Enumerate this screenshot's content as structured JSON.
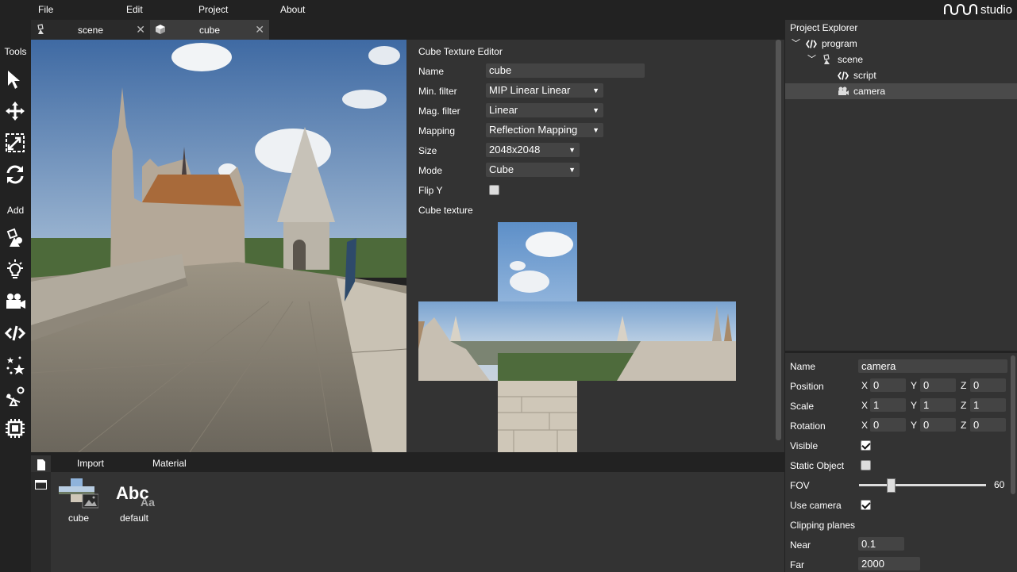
{
  "menu": {
    "file": "File",
    "edit": "Edit",
    "project": "Project",
    "about": "About"
  },
  "logo": {
    "text": "studio"
  },
  "tabs": [
    {
      "label": "scene",
      "icon": "scene-icon",
      "active": false
    },
    {
      "label": "cube",
      "icon": "cube-icon",
      "active": true
    }
  ],
  "tools": {
    "tools_heading": "Tools",
    "add_heading": "Add"
  },
  "editor": {
    "title": "Cube Texture Editor",
    "name_label": "Name",
    "name_value": "cube",
    "min_filter_label": "Min. filter",
    "min_filter_value": "MIP Linear Linear",
    "mag_filter_label": "Mag. filter",
    "mag_filter_value": "Linear",
    "mapping_label": "Mapping",
    "mapping_value": "Reflection Mapping",
    "size_label": "Size",
    "size_value": "2048x2048",
    "mode_label": "Mode",
    "mode_value": "Cube",
    "flipy_label": "Flip Y",
    "flipy_checked": false,
    "cube_texture_label": "Cube texture"
  },
  "assets": {
    "tabs": [
      "Import",
      "Material"
    ],
    "items": [
      {
        "label": "cube"
      },
      {
        "label": "default",
        "glyph": "Abc",
        "sub": "Aa"
      }
    ]
  },
  "explorer": {
    "title": "Project Explorer",
    "items": [
      {
        "label": "program",
        "icon": "code-icon"
      },
      {
        "label": "scene",
        "icon": "scene-icon"
      },
      {
        "label": "script",
        "icon": "code-icon"
      },
      {
        "label": "camera",
        "icon": "camera-icon",
        "selected": true
      }
    ]
  },
  "inspector": {
    "name_label": "Name",
    "name_value": "camera",
    "position_label": "Position",
    "position": {
      "x": "0",
      "y": "0",
      "z": "0"
    },
    "scale_label": "Scale",
    "scale": {
      "x": "1",
      "y": "1",
      "z": "1"
    },
    "rotation_label": "Rotation",
    "rotation": {
      "x": "0",
      "y": "0",
      "z": "0"
    },
    "axis_x": "X",
    "axis_y": "Y",
    "axis_z": "Z",
    "visible_label": "Visible",
    "visible": true,
    "static_label": "Static Object",
    "static": false,
    "fov_label": "FOV",
    "fov_value": "60",
    "fov_fraction": 0.25,
    "use_camera_label": "Use camera",
    "use_camera": true,
    "clipping_label": "Clipping planes",
    "near_label": "Near",
    "near_value": "0.1",
    "far_label": "Far",
    "far_value": "2000"
  },
  "colors": {
    "panel": "#333333",
    "background": "#222222",
    "selected": "#4a4a4a",
    "input": "#444444"
  }
}
